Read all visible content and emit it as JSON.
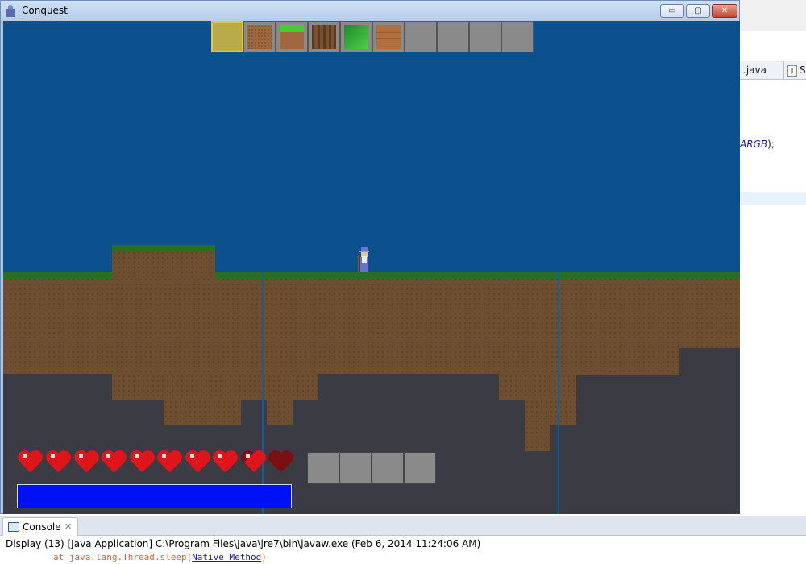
{
  "window": {
    "title": "Conquest",
    "min_symbol": "▭",
    "max_symbol": "▢",
    "close_symbol": "✕",
    "icon": "wizard-app-icon"
  },
  "hotbar": {
    "selected_index": 0,
    "slots": [
      "empty-selected",
      "dirt-block",
      "grass-block",
      "wood-log",
      "leaves-block",
      "wood-plank",
      "empty",
      "empty",
      "empty",
      "empty"
    ]
  },
  "hud": {
    "hearts_total": 10,
    "hearts_full": 9,
    "hearts_state": [
      "full",
      "full",
      "full",
      "full",
      "full",
      "full",
      "full",
      "full",
      "half",
      "empty"
    ],
    "inventory_slots": 4,
    "mana_fraction": 1.0
  },
  "ide": {
    "tab1": ".java",
    "tab2": "S",
    "code_fragment": "ARGB",
    "code_suffix": ");"
  },
  "console": {
    "tab_label": "Console",
    "close_symbol": "✕",
    "description": "Display (13) [Java Application] C:\\Program Files\\Java\\jre7\\bin\\javaw.exe (Feb 6, 2014 11:24:06 AM)",
    "trace_prefix": "at java.lang.Thread.sleep(",
    "trace_link": "Native Method",
    "trace_suffix": ")"
  },
  "colors": {
    "sky": "#0c508e",
    "dirt": "#6e4e31",
    "grass": "#2a6e1e",
    "cave": "#3a3b43",
    "heart": "#e0151c",
    "mana": "#0010f5"
  }
}
